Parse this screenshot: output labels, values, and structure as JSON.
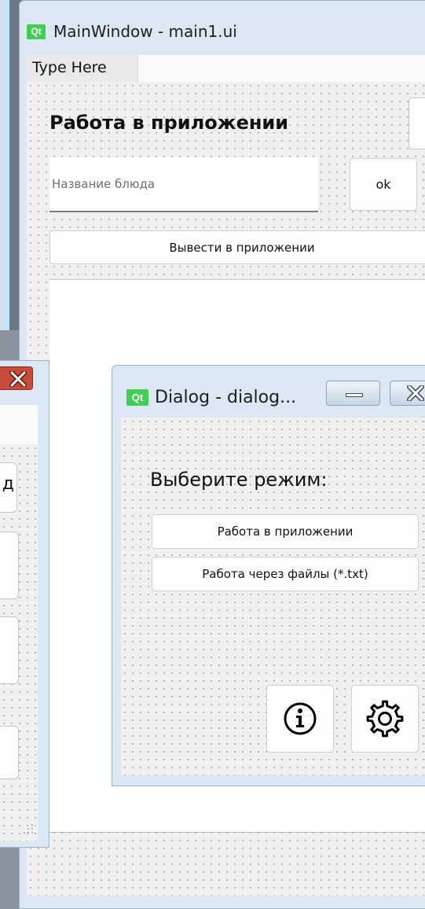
{
  "main_window": {
    "title": "MainWindow - main1.ui",
    "app_badge": "Qt",
    "menu_item": "Type Here",
    "heading": "Работа в приложении",
    "input_placeholder": "Название блюда",
    "input_value": "",
    "ok_label": "ok",
    "show_label": "Вывести в приложении"
  },
  "left_dialog": {
    "fragment_letter": "д"
  },
  "dialog": {
    "title": "Dialog - dialog...",
    "app_badge": "Qt",
    "heading": "Выберите режим:",
    "mode_app_label": "Работа в приложении",
    "mode_files_label": "Работа через файлы (*.txt)",
    "info_icon": "info-icon",
    "settings_icon": "gear-icon"
  },
  "colors": {
    "qt_green": "#41cd52",
    "window_frame": "#dbe7f3",
    "close_red": "#c84a3a"
  }
}
